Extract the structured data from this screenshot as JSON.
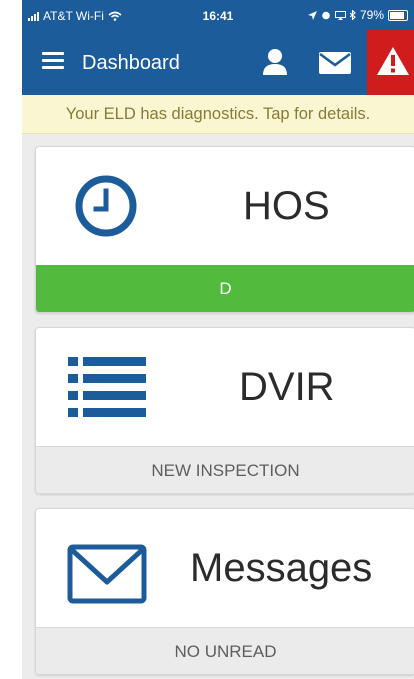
{
  "status_bar": {
    "carrier": "AT&T Wi-Fi",
    "time": "16:41",
    "battery": "79%"
  },
  "app_bar": {
    "title": "Dashboard",
    "icons": [
      "menu-icon",
      "user-icon",
      "mail-icon",
      "warning-icon"
    ]
  },
  "banner": {
    "text": "Your ELD has diagnostics. Tap for details."
  },
  "cards": {
    "hos": {
      "label": "HOS",
      "status": "D",
      "icon": "clock-icon"
    },
    "dvir": {
      "label": "DVIR",
      "status": "NEW INSPECTION",
      "icon": "list-icon"
    },
    "messages": {
      "label": "Messages",
      "status": "NO UNREAD",
      "icon": "envelope-icon"
    }
  },
  "colors": {
    "primary": "#1d5c9a",
    "alert": "#d01c1c",
    "banner_bg": "#fbf6d2",
    "status_green": "#52bb3e"
  }
}
